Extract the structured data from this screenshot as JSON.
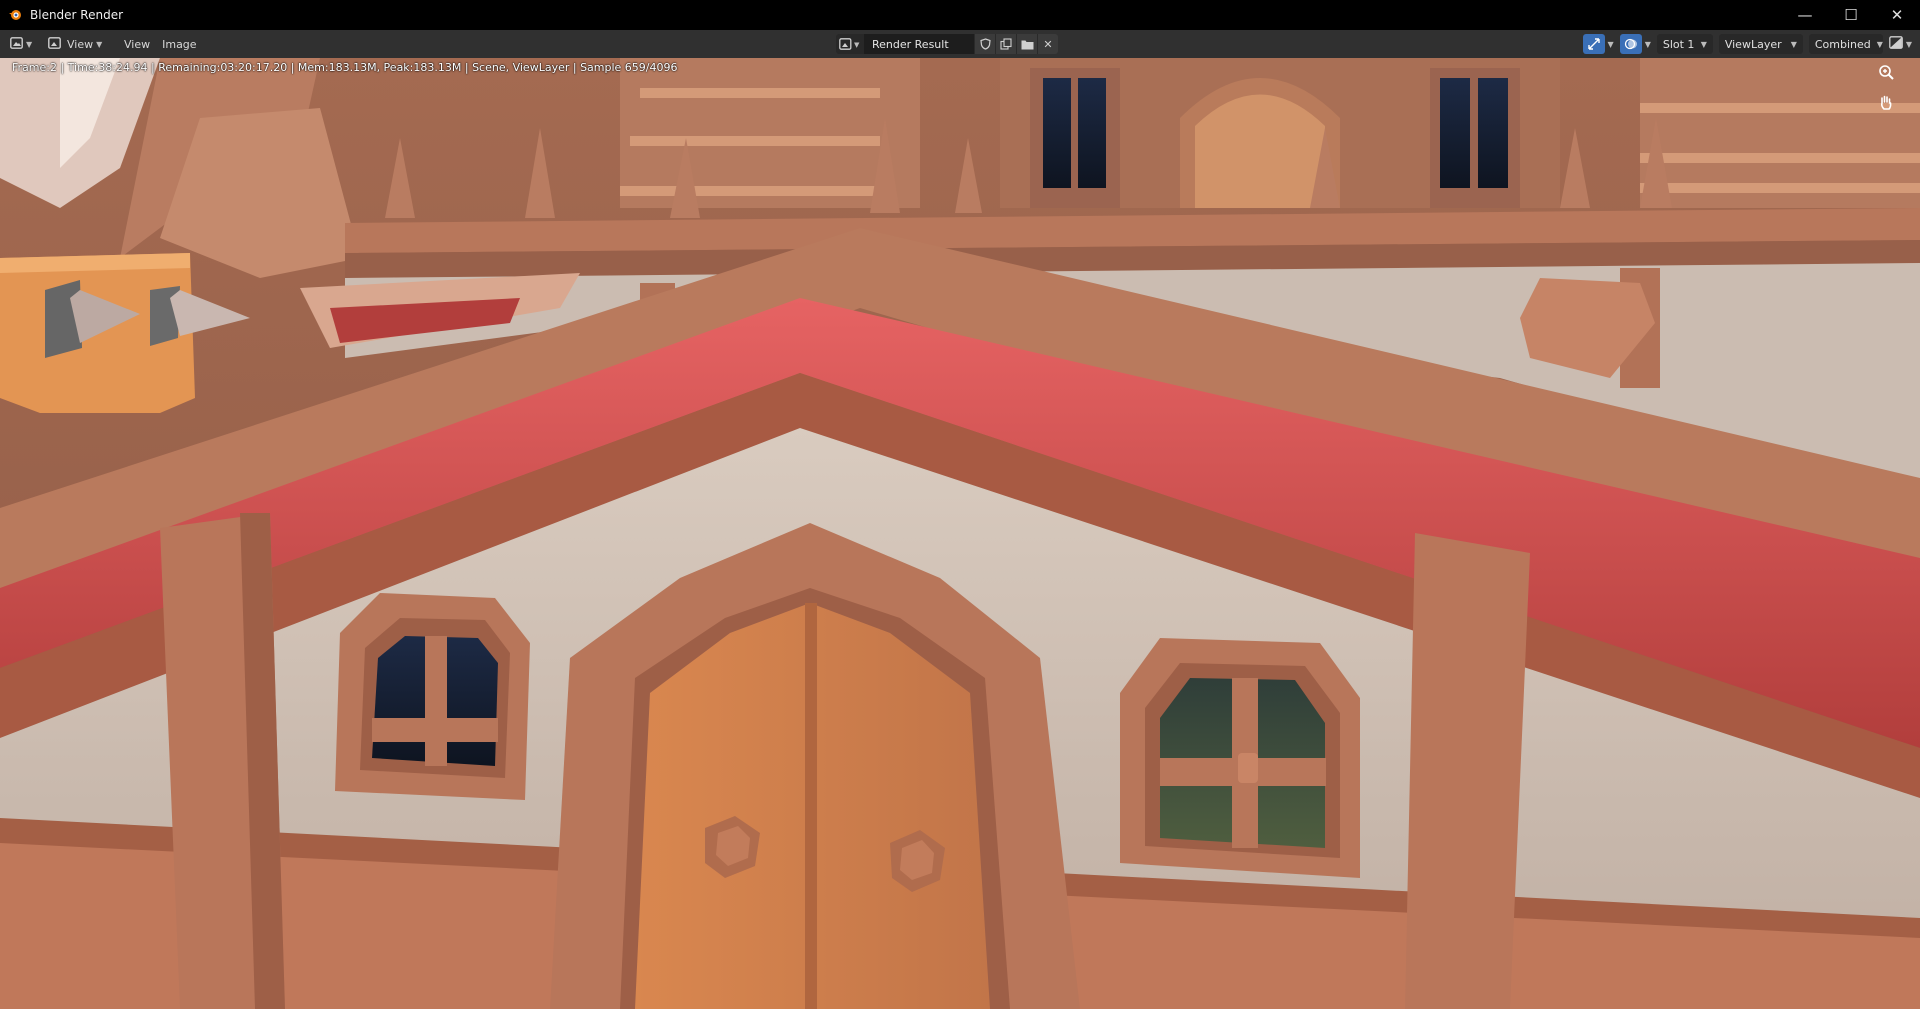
{
  "window": {
    "title": "Blender Render",
    "app_icon": "blender-logo-icon",
    "controls": {
      "minimize": "—",
      "maximize": "☐",
      "close": "✕"
    }
  },
  "header": {
    "editor_type_icon": "image-editor-icon",
    "mode_icon": "view-mode-icon",
    "mode_label": "View",
    "menus": [
      "View",
      "Image"
    ],
    "image": {
      "browse_icon": "image-browse-icon",
      "name": "Render Result",
      "buttons": [
        "shield-icon",
        "duplicate-icon",
        "open-folder-icon",
        "close-icon"
      ]
    },
    "gizmo_toggle_active": true,
    "overlay_toggle_active": true,
    "slot": "Slot 1",
    "view_layer": "ViewLayer",
    "pass": "Combined",
    "display_channels_icon": "display-channels-icon",
    "accent_color": "#3a6fb7"
  },
  "render": {
    "status_text": "Frame:2 | Time:38:24.94 | Remaining:03:20:17.20 | Mem:183.13M, Peak:183.13M | Scene, ViewLayer | Sample 659/4096",
    "nav_icons": [
      "zoom-icon",
      "pan-hand-icon"
    ]
  }
}
